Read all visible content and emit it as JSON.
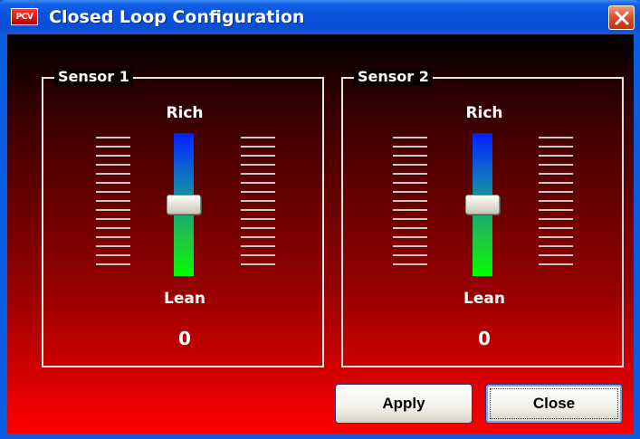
{
  "window": {
    "icon_text": "PCV",
    "title": "Closed Loop Configuration"
  },
  "sensors": [
    {
      "legend": "Sensor 1",
      "top_label": "Rich",
      "bottom_label": "Lean",
      "value": "0",
      "slider_level": 0.5
    },
    {
      "legend": "Sensor 2",
      "top_label": "Rich",
      "bottom_label": "Lean",
      "value": "0",
      "slider_level": 0.5
    }
  ],
  "buttons": {
    "apply_label": "Apply",
    "close_label": "Close"
  },
  "colors": {
    "rich_color": "#0020ff",
    "lean_color": "#00ff00",
    "background_top": "#000000",
    "background_bottom": "#ff0000"
  }
}
